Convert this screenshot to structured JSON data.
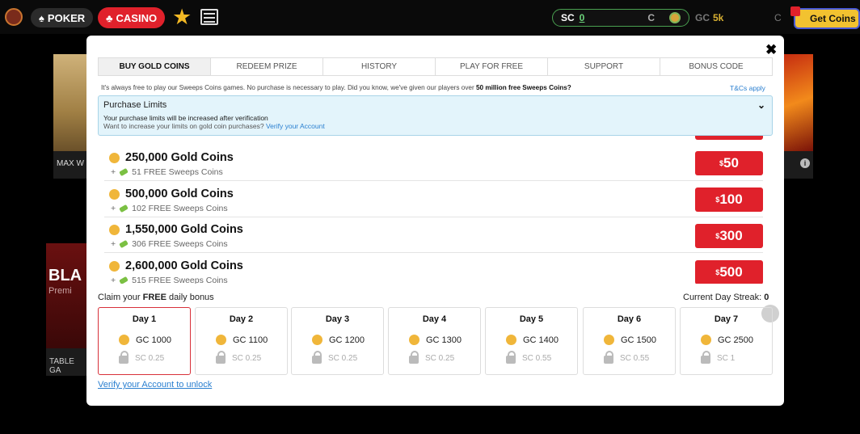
{
  "topbar": {
    "poker_label": "POKER",
    "casino_label": "CASINO",
    "sc_label": "SC",
    "sc_value": "0",
    "gc_label": "GC",
    "gc_value": "5k",
    "get_coins_label": "Get Coins"
  },
  "background": {
    "tile1_caption": "MAX W",
    "tile3_title": "BLA",
    "tile3_sub": "Premi",
    "tile3_caption": "TABLE GA"
  },
  "tabs": [
    "BUY GOLD COINS",
    "REDEEM PRIZE",
    "HISTORY",
    "PLAY FOR FREE",
    "SUPPORT",
    "BONUS CODE"
  ],
  "info": {
    "text_pre": "It's always free to play our Sweeps Coins games. No purchase is necessary to play. Did you know, we've given our players over ",
    "text_bold": "50 million free Sweeps Coins?",
    "tcs": "T&Cs apply"
  },
  "limits": {
    "title": "Purchase Limits",
    "line1": "Your purchase limits will be increased after verification",
    "line2": "Want to increase your limits on gold coin purchases?",
    "line2_link": "Verify your Account"
  },
  "packages": [
    {
      "name": "250,000 Gold Coins",
      "bonus": "51 FREE Sweeps Coins",
      "price": "50"
    },
    {
      "name": "500,000 Gold Coins",
      "bonus": "102 FREE Sweeps Coins",
      "price": "100"
    },
    {
      "name": "1,550,000 Gold Coins",
      "bonus": "306 FREE Sweeps Coins",
      "price": "300"
    },
    {
      "name": "2,600,000 Gold Coins",
      "bonus": "515 FREE Sweeps Coins",
      "price": "500"
    }
  ],
  "daily": {
    "claim_pre": "Claim your ",
    "claim_bold": "FREE",
    "claim_post": " daily bonus",
    "streak_label": "Current Day Streak: ",
    "streak_value": "0",
    "days": [
      {
        "label": "Day 1",
        "gc": "GC 1000",
        "sc": "SC 0.25"
      },
      {
        "label": "Day 2",
        "gc": "GC 1100",
        "sc": "SC 0.25"
      },
      {
        "label": "Day 3",
        "gc": "GC 1200",
        "sc": "SC 0.25"
      },
      {
        "label": "Day 4",
        "gc": "GC 1300",
        "sc": "SC 0.25"
      },
      {
        "label": "Day 5",
        "gc": "GC 1400",
        "sc": "SC 0.55"
      },
      {
        "label": "Day 6",
        "gc": "GC 1500",
        "sc": "SC 0.55"
      },
      {
        "label": "Day 7",
        "gc": "GC 2500",
        "sc": "SC 1"
      }
    ],
    "verify_link": "Verify your Account to unlock"
  }
}
